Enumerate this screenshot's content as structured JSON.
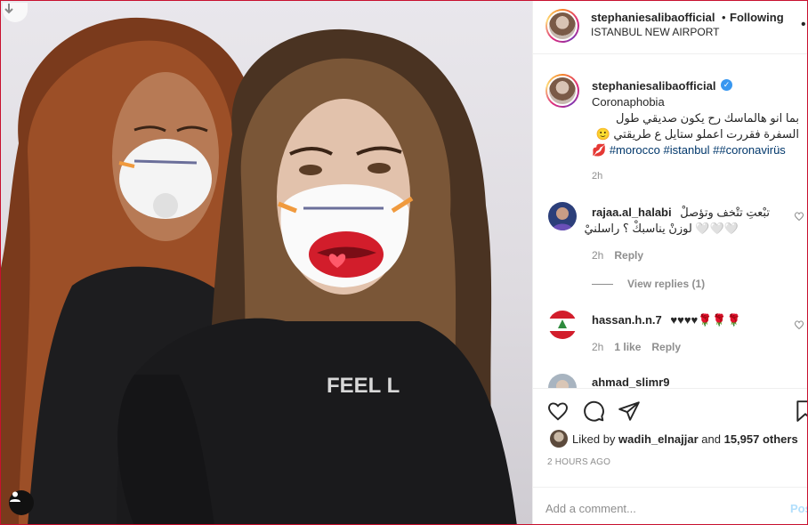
{
  "post": {
    "username": "stephaniesalibaofficial",
    "follow_separator": "•",
    "follow_status": "Following",
    "location": "ISTANBUL NEW AIRPORT",
    "more_icon": "more-horizontal-icon",
    "photo_mask_shirt_text": "FEEL L"
  },
  "caption": {
    "username": "stephaniesalibaofficial",
    "verified_icon": "verified-badge-icon",
    "line1": "Coronaphobia",
    "line2": "بما انو هالماسك رح يكون صديقي طول",
    "line3": "السفرة فقررت اعملو ستايل ع طريقتي 🙂",
    "line4_emoji": "💋",
    "hashtags": "#morocco #istanbul ##coronavirüs",
    "time": "2h"
  },
  "comments": [
    {
      "username": "rajaa.al_halabi",
      "text1": "تبْعتِ تتْخف وتؤصلْ",
      "text2": "🤍🤍🤍 لوزنْ يناسبكْ ؟ راسلنيْ",
      "time": "2h",
      "reply": "Reply",
      "view_replies": "View replies (1)"
    },
    {
      "username": "hassan.h.n.7",
      "text1": "♥♥♥♥🌹🌹🌹",
      "time": "2h",
      "likes": "1 like",
      "reply": "Reply"
    },
    {
      "username": "ahmad_slimr9"
    }
  ],
  "actions": {
    "like_icon": "heart-icon",
    "comment_icon": "comment-icon",
    "share_icon": "share-icon",
    "save_icon": "bookmark-icon",
    "liked_by_prefix": "Liked by",
    "liked_by_user": "wadih_elnajjar",
    "and": "and",
    "others": "15,957 others",
    "post_time": "2 HOURS AGO",
    "comment_placeholder": "Add a comment...",
    "post_label": "Post"
  },
  "colors": {
    "link_blue": "#00376b",
    "verified_blue": "#3897f0",
    "post_button_disabled": "#b2dffc",
    "muted_text": "#8e8e8e"
  }
}
